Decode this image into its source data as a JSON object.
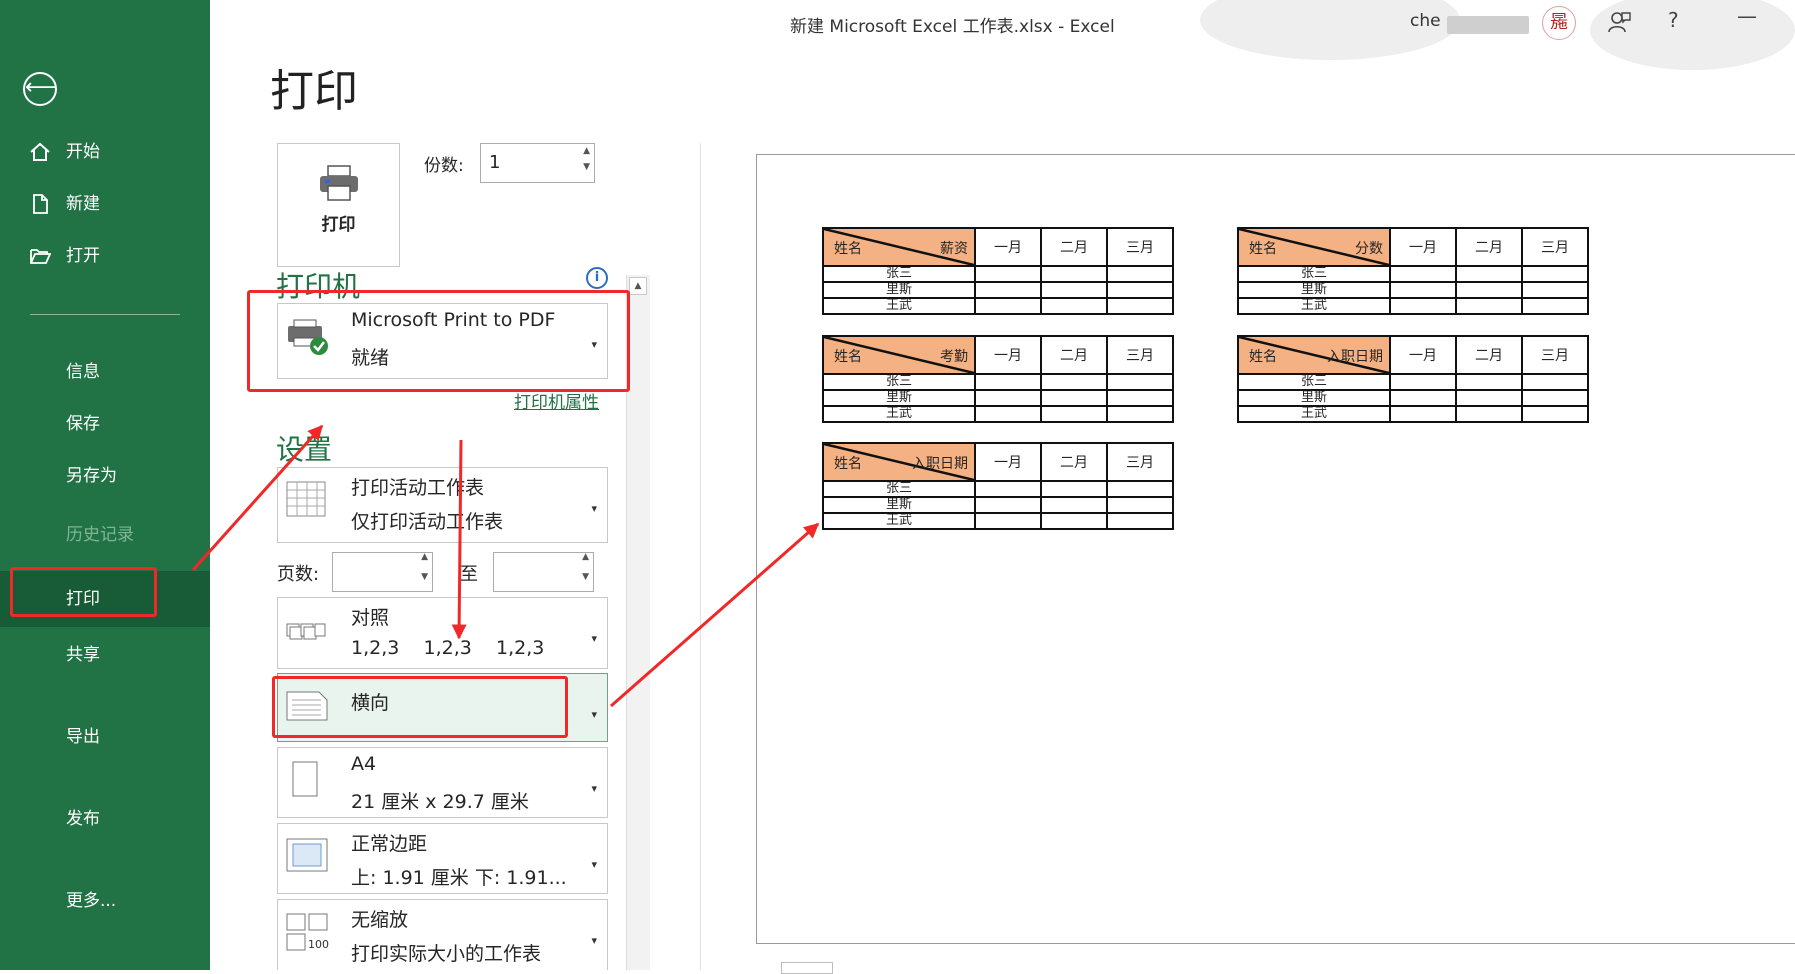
{
  "window": {
    "title": "新建 Microsoft Excel 工作表.xlsx  -  Excel",
    "user": "che"
  },
  "avatar_text": "㒾",
  "top_icons": [
    "feedback-icon",
    "help-icon",
    "minimize-icon"
  ],
  "top_icon_glyphs": {
    "help": "?",
    "minimize": "—"
  },
  "nav": {
    "back": "⟵",
    "items": [
      {
        "label": "开始",
        "icon": "home-icon"
      },
      {
        "label": "新建",
        "icon": "new-document-icon"
      },
      {
        "label": "打开",
        "icon": "open-folder-icon"
      },
      {
        "label": "信息"
      },
      {
        "label": "保存"
      },
      {
        "label": "另存为"
      },
      {
        "label": "历史记录",
        "disabled": true
      },
      {
        "label": "打印",
        "active": true
      },
      {
        "label": "共享"
      },
      {
        "label": "导出"
      },
      {
        "label": "发布"
      },
      {
        "label": "更多..."
      }
    ]
  },
  "print_pane": {
    "title": "打印",
    "print_button": "打印",
    "copies_label": "份数:",
    "copies_value": "1",
    "printer_heading": "打印机",
    "printer": {
      "name": "Microsoft Print to PDF",
      "status": "就绪"
    },
    "printer_properties": "打印机属性",
    "settings_heading": "设置",
    "settings": [
      {
        "line1": "打印活动工作表",
        "line2": "仅打印活动工作表",
        "icon": "sheet-grid-icon"
      },
      {
        "line1": "对照",
        "line2": "1,2,3    1,2,3    1,2,3",
        "icon": "collate-icon"
      },
      {
        "line1": "横向",
        "line2": "",
        "icon": "landscape-icon"
      },
      {
        "line1": "A4",
        "line2": "21 厘米 x 29.7 厘米",
        "icon": "paper-size-icon"
      },
      {
        "line1": "正常边距",
        "line2": "上: 1.91 厘米 下: 1.91...",
        "icon": "margins-icon"
      },
      {
        "line1": "无缩放",
        "line2": "打印实际大小的工作表",
        "icon": "scaling-icon"
      }
    ],
    "pages_label": "页数:",
    "pages_to": "至",
    "caret": "▾",
    "info": "i"
  },
  "preview": {
    "tables": [
      {
        "header": [
          "姓名",
          "薪资"
        ],
        "months": [
          "一月",
          "二月",
          "三月"
        ],
        "rows": [
          "张三",
          "里斯",
          "王武"
        ]
      },
      {
        "header": [
          "姓名",
          "分数"
        ],
        "months": [
          "一月",
          "二月",
          "三月"
        ],
        "rows": [
          "张三",
          "里斯",
          "王武"
        ]
      },
      {
        "header": [
          "姓名",
          "考勤"
        ],
        "months": [
          "一月",
          "二月",
          "三月"
        ],
        "rows": [
          "张三",
          "里斯",
          "王武"
        ]
      },
      {
        "header": [
          "姓名",
          "入职日期"
        ],
        "months": [
          "一月",
          "二月",
          "三月"
        ],
        "rows": [
          "张三",
          "里斯",
          "王武"
        ]
      },
      {
        "header": [
          "姓名",
          "入职日期"
        ],
        "months": [
          "一月",
          "二月",
          "三月"
        ],
        "rows": [
          "张三",
          "里斯",
          "王武"
        ]
      }
    ]
  },
  "colors": {
    "nav_bg": "#217346",
    "accent_green": "#217346",
    "annotation_red": "#f02828",
    "header_fill": "#f4b183"
  }
}
